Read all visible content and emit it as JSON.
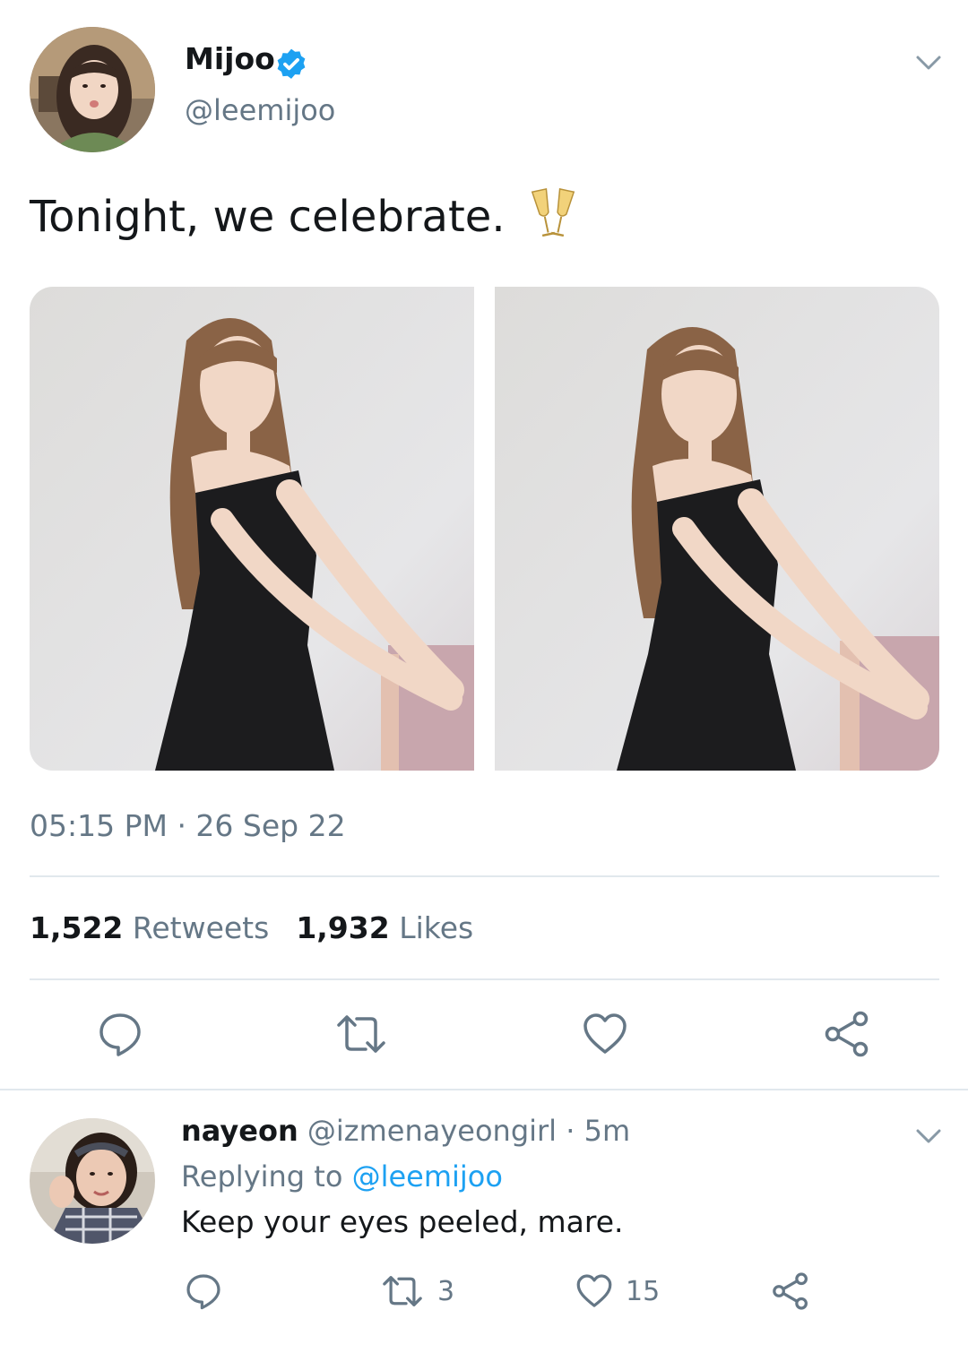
{
  "tweet": {
    "author": {
      "name": "Mijoo",
      "handle": "@leemijoo",
      "verified": true
    },
    "text": "Tonight, we celebrate.",
    "emoji": "clinking-glasses",
    "timestamp": "05:15 PM · 26 Sep 22",
    "stats": {
      "retweets_count": "1,522",
      "retweets_label": "Retweets",
      "likes_count": "1,932",
      "likes_label": "Likes"
    },
    "photos": [
      "photo-1",
      "photo-2"
    ]
  },
  "reply": {
    "author": {
      "name": "nayeon",
      "handle": "@izmenayeongirl",
      "time": "· 5m"
    },
    "replying_to_label": "Replying to",
    "replying_to_handle": "@leemijoo",
    "text": "Keep your eyes peeled, mare.",
    "retweet_count": "3",
    "like_count": "15"
  },
  "colors": {
    "accent": "#1da1f2",
    "text_primary": "#14171a",
    "text_secondary": "#657786",
    "divider": "#e1e8ed"
  }
}
